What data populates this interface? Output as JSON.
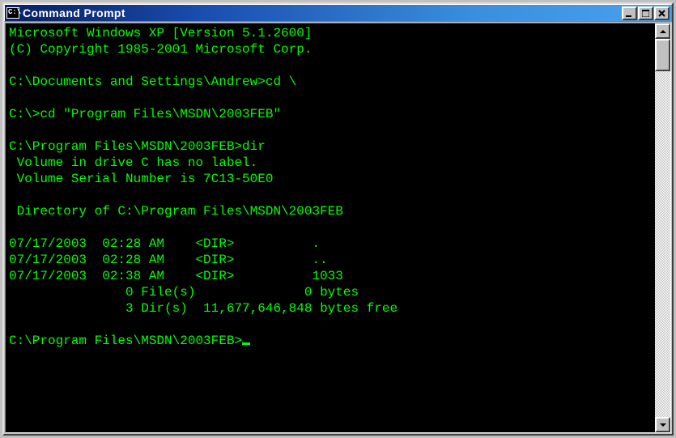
{
  "window": {
    "title": "Command Prompt"
  },
  "console": {
    "lines": [
      "Microsoft Windows XP [Version 5.1.2600]",
      "(C) Copyright 1985-2001 Microsoft Corp.",
      "",
      "C:\\Documents and Settings\\Andrew>cd \\",
      "",
      "C:\\>cd \"Program Files\\MSDN\\2003FEB\"",
      "",
      "C:\\Program Files\\MSDN\\2003FEB>dir",
      " Volume in drive C has no label.",
      " Volume Serial Number is 7C13-50E0",
      "",
      " Directory of C:\\Program Files\\MSDN\\2003FEB",
      "",
      "07/17/2003  02:28 AM    <DIR>          .",
      "07/17/2003  02:28 AM    <DIR>          ..",
      "07/17/2003  02:38 AM    <DIR>          1033",
      "               0 File(s)              0 bytes",
      "               3 Dir(s)  11,677,646,848 bytes free",
      "",
      "C:\\Program Files\\MSDN\\2003FEB>"
    ]
  }
}
